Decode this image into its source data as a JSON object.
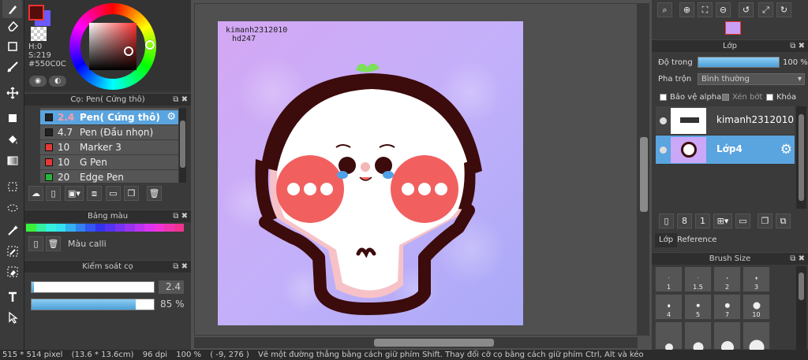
{
  "color_picker": {
    "hue": "H:0",
    "saturation": "S:219",
    "hex": "#550C0C",
    "foreground_color": "#550c0c",
    "background_color": "#6a5aff"
  },
  "brush_panel": {
    "title": "Cọ: Pen( Cứng thô)",
    "brushes": [
      {
        "size": "2.4",
        "name": "Pen( Cứng thô)",
        "color": "#222222",
        "selected": true
      },
      {
        "size": "4.7",
        "name": "Pen (Đầu nhọn)",
        "color": "#222222",
        "selected": false
      },
      {
        "size": "10",
        "name": "Marker 3",
        "color": "#e53935",
        "selected": false
      },
      {
        "size": "10",
        "name": "G Pen",
        "color": "#e53935",
        "selected": false
      },
      {
        "size": "20",
        "name": "Edge Pen",
        "color": "#2ab33a",
        "selected": false
      }
    ]
  },
  "palette_panel": {
    "title": "Bảng màu",
    "name": "Màu calli",
    "colors": [
      "#3bf23b",
      "#33f0a0",
      "#33f0e0",
      "#33e0f0",
      "#33b0f0",
      "#3380f0",
      "#3355f0",
      "#3333f0",
      "#5533f0",
      "#7733f0",
      "#9933f0",
      "#bb33f0",
      "#dd33f0",
      "#f033d8",
      "#f033b0",
      "#f03390"
    ]
  },
  "brush_control": {
    "title": "Kiểm soát cọ",
    "size_value": "2.4",
    "size_fraction": 0.02,
    "opacity_value": "85 %",
    "opacity_fraction": 0.85
  },
  "artwork": {
    "watermark_line1": "kimanh2312010",
    "watermark_line2": "hd247"
  },
  "layer_panel": {
    "title": "Lớp",
    "opacity_label": "Độ trong",
    "opacity_value": "100 %",
    "blend_label": "Pha trộn",
    "blend_value": "Bình thường",
    "protect_alpha": "Bảo vệ alpha",
    "clipping": "Xén bớt",
    "lock": "Khóa",
    "layers": [
      {
        "name": "kimanh2312010",
        "selected": false
      },
      {
        "name": "Lớp4",
        "selected": true
      }
    ],
    "tabs": [
      "Lớp",
      "Reference"
    ]
  },
  "brush_size_panel": {
    "title": "Brush Size",
    "sizes": [
      "1",
      "1.5",
      "2",
      "3",
      "4",
      "5",
      "7",
      "10"
    ]
  },
  "status_bar": {
    "dimensions": "515 * 514 pixel",
    "physical": "(13.6 * 13.6cm)",
    "dpi": "96 dpi",
    "zoom": "100 %",
    "cursor": "( -9, 276 )",
    "hint": "Vẽ một đường thẳng bằng cách giữ phím Shift. Thay đổi cỡ cọ bằng cách giữ phím Ctrl, Alt và kéo"
  }
}
